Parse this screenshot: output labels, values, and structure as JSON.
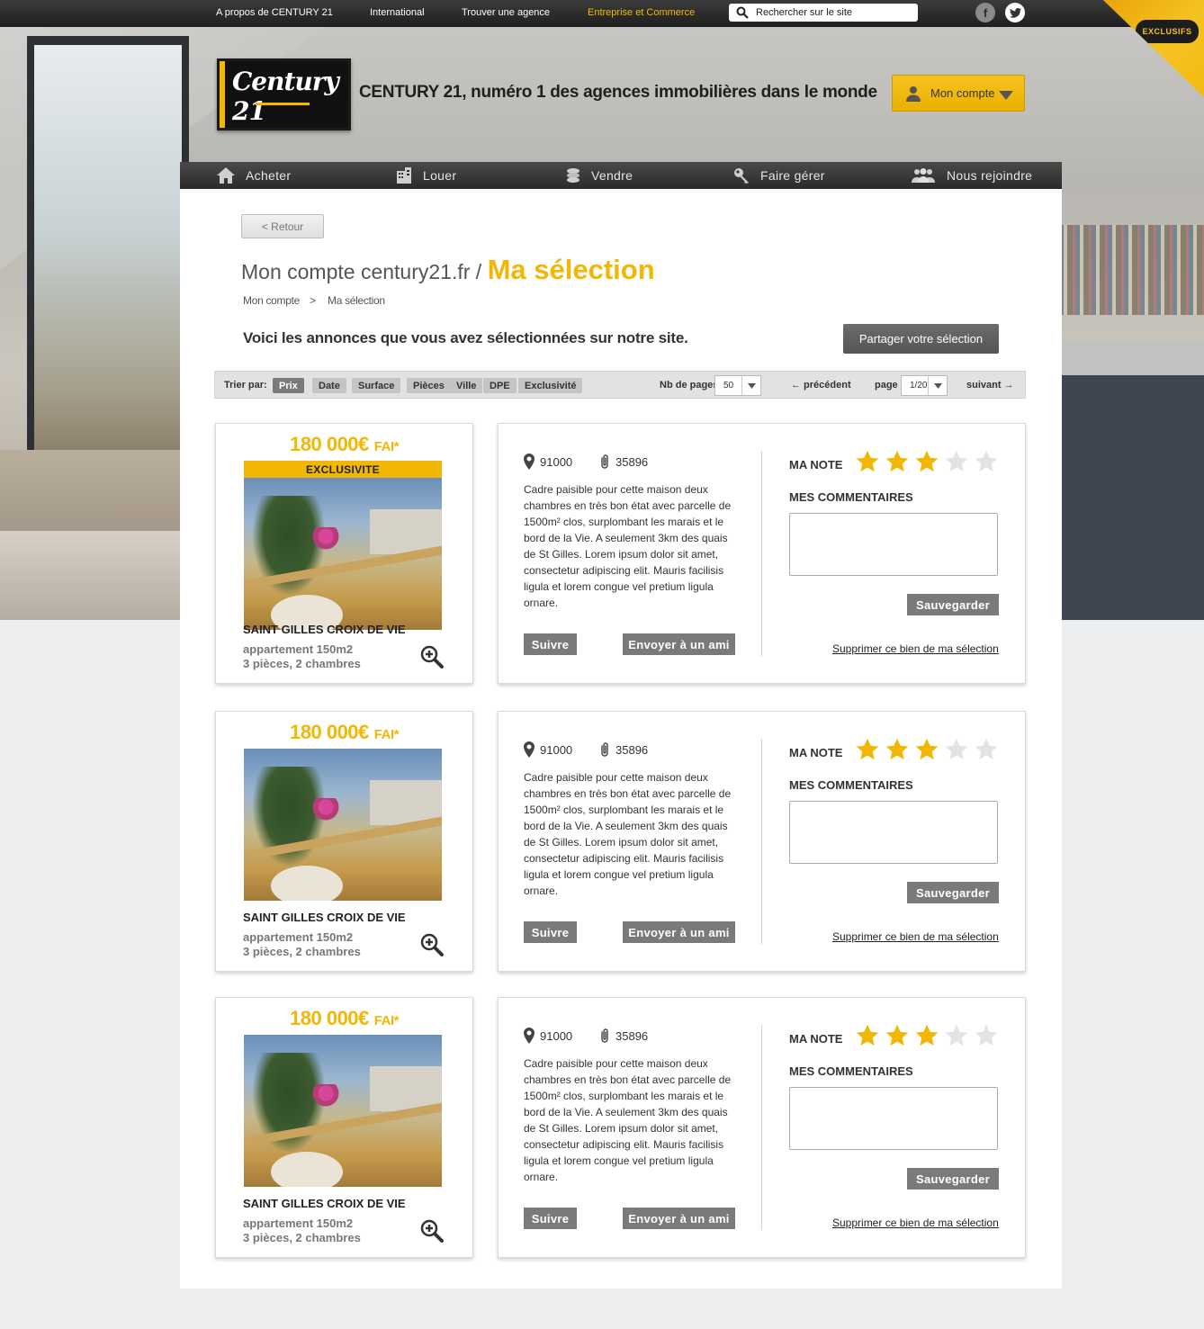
{
  "topbar": {
    "links": [
      "A propos de CENTURY 21",
      "International",
      "Trouver une agence",
      "Entreprise et Commerce"
    ],
    "search_placeholder": "Rechercher sur le site",
    "social": [
      "f",
      "t"
    ],
    "corner_badge": "EXCLUSIFS"
  },
  "header": {
    "logo_text": "Century 21",
    "tagline": "CENTURY 21, numéro 1 des agences immobilières dans le monde",
    "account_label": "Mon compte"
  },
  "nav": [
    "Acheter",
    "Louer",
    "Vendre",
    "Faire gérer",
    "Nous rejoindre"
  ],
  "page": {
    "back_label": "<   Retour",
    "title_prefix": "Mon compte century21.fr /",
    "title_highlight": "Ma sélection",
    "breadcrumb": [
      "Mon compte",
      ">",
      "Ma sélection"
    ],
    "intro": "Voici les annonces que vous avez sélectionnées sur notre site.",
    "share_label": "Partager votre sélection"
  },
  "sortbar": {
    "label": "Trier par:",
    "options": [
      "Prix",
      "Date",
      "Surface",
      "Pièces",
      "Ville",
      "DPE",
      "Exclusivité"
    ],
    "active": "Prix",
    "pages_label": "Nb de pages",
    "pages_value": "50",
    "prev_label": "←  précédent",
    "page_label": "page",
    "page_value": "1/20",
    "next_label": "suivant  →"
  },
  "listings": [
    {
      "price": "180 000€",
      "fai": "FAI*",
      "exclusive": "EXCLUSIVITE",
      "city": "SAINT GILLES  CROIX DE VIE",
      "type": "appartement 150m2",
      "rooms": "3 pièces, 2 chambres",
      "postcode": "91000",
      "ref": "35896",
      "description": "Cadre paisible pour cette maison deux chambres en très bon état avec parcelle de 1500m² clos, surplombant les marais et le bord de la Vie. A seulement 3km des quais de St Gilles. Lorem ipsum dolor sit amet, consectetur adipiscing elit. Mauris facilisis ligula et lorem congue vel pretium ligula ornare.",
      "follow_label": "Suivre",
      "send_label": "Envoyer à un ami",
      "note_label": "MA NOTE",
      "rating": 3,
      "rating_max": 5,
      "comments_label": "MES COMMENTAIRES",
      "save_label": "Sauvegarder",
      "delete_label": "Supprimer ce bien de ma sélection"
    },
    {
      "price": "180 000€",
      "fai": "FAI*",
      "exclusive": "",
      "city": "SAINT GILLES  CROIX DE VIE",
      "type": "appartement 150m2",
      "rooms": "3 pièces, 2 chambres",
      "postcode": "91000",
      "ref": "35896",
      "description": "Cadre paisible pour cette maison deux chambres en très bon état avec parcelle de 1500m² clos, surplombant les marais et le bord de la Vie. A seulement 3km des quais de St Gilles. Lorem ipsum dolor sit amet, consectetur adipiscing elit. Mauris facilisis ligula et lorem congue vel pretium ligula ornare.",
      "follow_label": "Suivre",
      "send_label": "Envoyer à un ami",
      "note_label": "MA NOTE",
      "rating": 3,
      "rating_max": 5,
      "comments_label": "MES COMMENTAIRES",
      "save_label": "Sauvegarder",
      "delete_label": "Supprimer ce bien de ma sélection"
    },
    {
      "price": "180 000€",
      "fai": "FAI*",
      "exclusive": "",
      "city": "SAINT GILLES  CROIX DE VIE",
      "type": "appartement 150m2",
      "rooms": "3 pièces, 2 chambres",
      "postcode": "91000",
      "ref": "35896",
      "description": "Cadre paisible pour cette maison deux chambres en très bon état avec parcelle de 1500m² clos, surplombant les marais et le bord de la Vie. A seulement 3km des quais de St Gilles. Lorem ipsum dolor sit amet, consectetur adipiscing elit. Mauris facilisis ligula et lorem congue vel pretium ligula ornare.",
      "follow_label": "Suivre",
      "send_label": "Envoyer à un ami",
      "note_label": "MA NOTE",
      "rating": 3,
      "rating_max": 5,
      "comments_label": "MES COMMENTAIRES",
      "save_label": "Sauvegarder",
      "delete_label": "Supprimer ce bien de ma sélection"
    }
  ],
  "colors": {
    "accent": "#f2b705",
    "star_on": "#f2b705",
    "star_off": "#e3e3e3",
    "button_grey": "#7a7a7a"
  }
}
